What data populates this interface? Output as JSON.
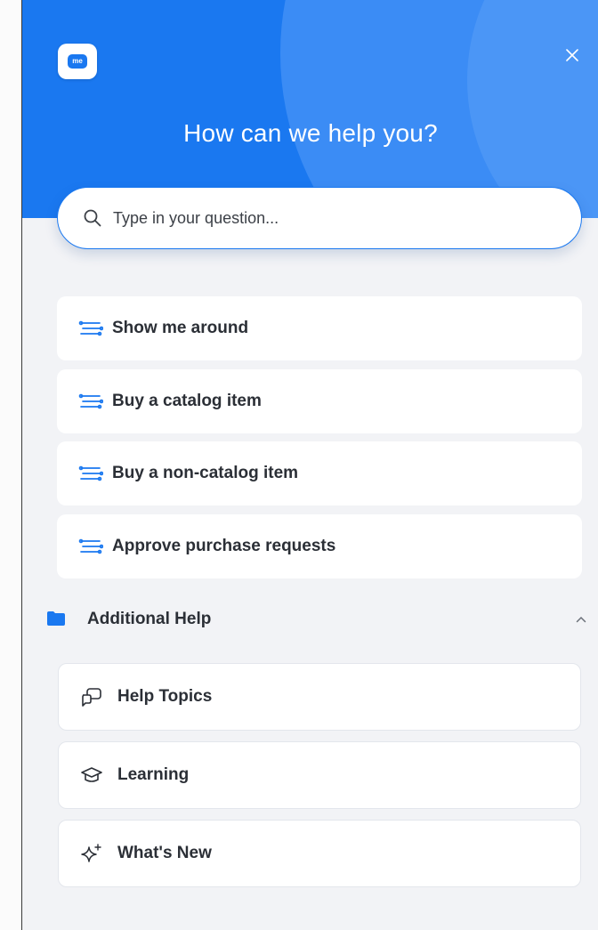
{
  "header": {
    "logo_text": "me",
    "title": "How can we help you?"
  },
  "search": {
    "placeholder": "Type in your question..."
  },
  "flows": [
    {
      "label": "Show me around",
      "icon": "flow-icon"
    },
    {
      "label": "Buy a catalog item",
      "icon": "flow-icon"
    },
    {
      "label": "Buy a non-catalog item",
      "icon": "flow-icon"
    },
    {
      "label": "Approve purchase requests",
      "icon": "flow-icon"
    }
  ],
  "additional": {
    "label": "Additional Help",
    "expanded": true,
    "items": [
      {
        "label": "Help Topics",
        "icon": "chat-bubbles-icon"
      },
      {
        "label": "Learning",
        "icon": "graduation-cap-icon"
      },
      {
        "label": "What's New",
        "icon": "sparkle-icon"
      }
    ]
  },
  "colors": {
    "accent": "#1a78f0",
    "panel_bg": "#f2f3f6",
    "text": "#2b2f36"
  }
}
